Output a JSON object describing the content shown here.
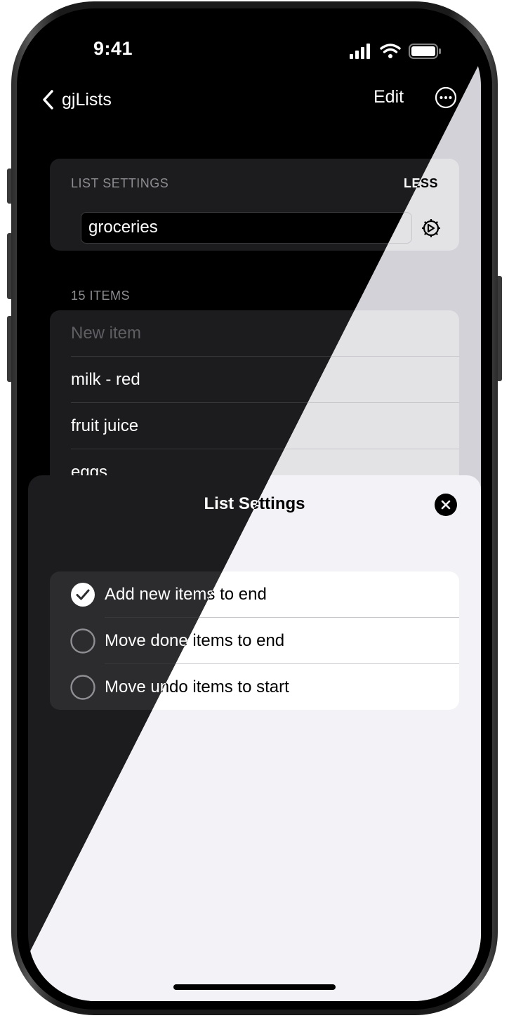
{
  "status_bar": {
    "time": "9:41"
  },
  "nav": {
    "back_label": "gjLists",
    "edit_label": "Edit"
  },
  "list_settings": {
    "header": "LIST SETTINGS",
    "less_label": "LESS",
    "list_name": "groceries"
  },
  "items": {
    "count_label": "15 ITEMS",
    "new_item_placeholder": "New item",
    "rows": [
      "milk - red",
      "fruit juice",
      "eggs"
    ]
  },
  "sheet": {
    "title": "List Settings",
    "options": [
      {
        "label": "Add new items to end",
        "checked": true
      },
      {
        "label": "Move done items to end",
        "checked": false
      },
      {
        "label": "Move undo items to start",
        "checked": false
      }
    ]
  },
  "icons": [
    "chevron-left-icon",
    "ellipsis-circle-icon",
    "gear-icon",
    "close-icon",
    "checkmark-icon",
    "signal-icon",
    "wifi-icon",
    "battery-icon"
  ],
  "colors": {
    "dark_background": "#000000",
    "dark_card": "#1c1c1e",
    "light_sheet": "#f2f2f7"
  }
}
